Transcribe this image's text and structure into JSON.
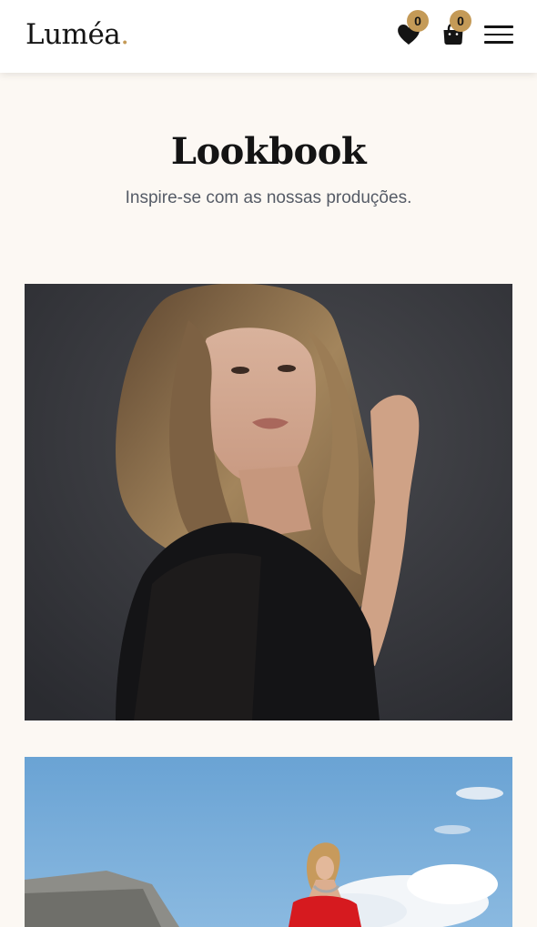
{
  "header": {
    "logo_text": "Luméa",
    "logo_dot": ".",
    "wishlist_count": "0",
    "cart_count": "0",
    "accent_color": "#c49a57"
  },
  "hero": {
    "title": "Lookbook",
    "subtitle": "Inspire-se com as nossas produções."
  },
  "icons": {
    "wishlist": "heart-icon",
    "cart": "shopping-bag-icon",
    "menu": "hamburger-menu-icon"
  },
  "lookbook": {
    "items": [
      {
        "id": "look-1"
      },
      {
        "id": "look-2"
      }
    ]
  }
}
